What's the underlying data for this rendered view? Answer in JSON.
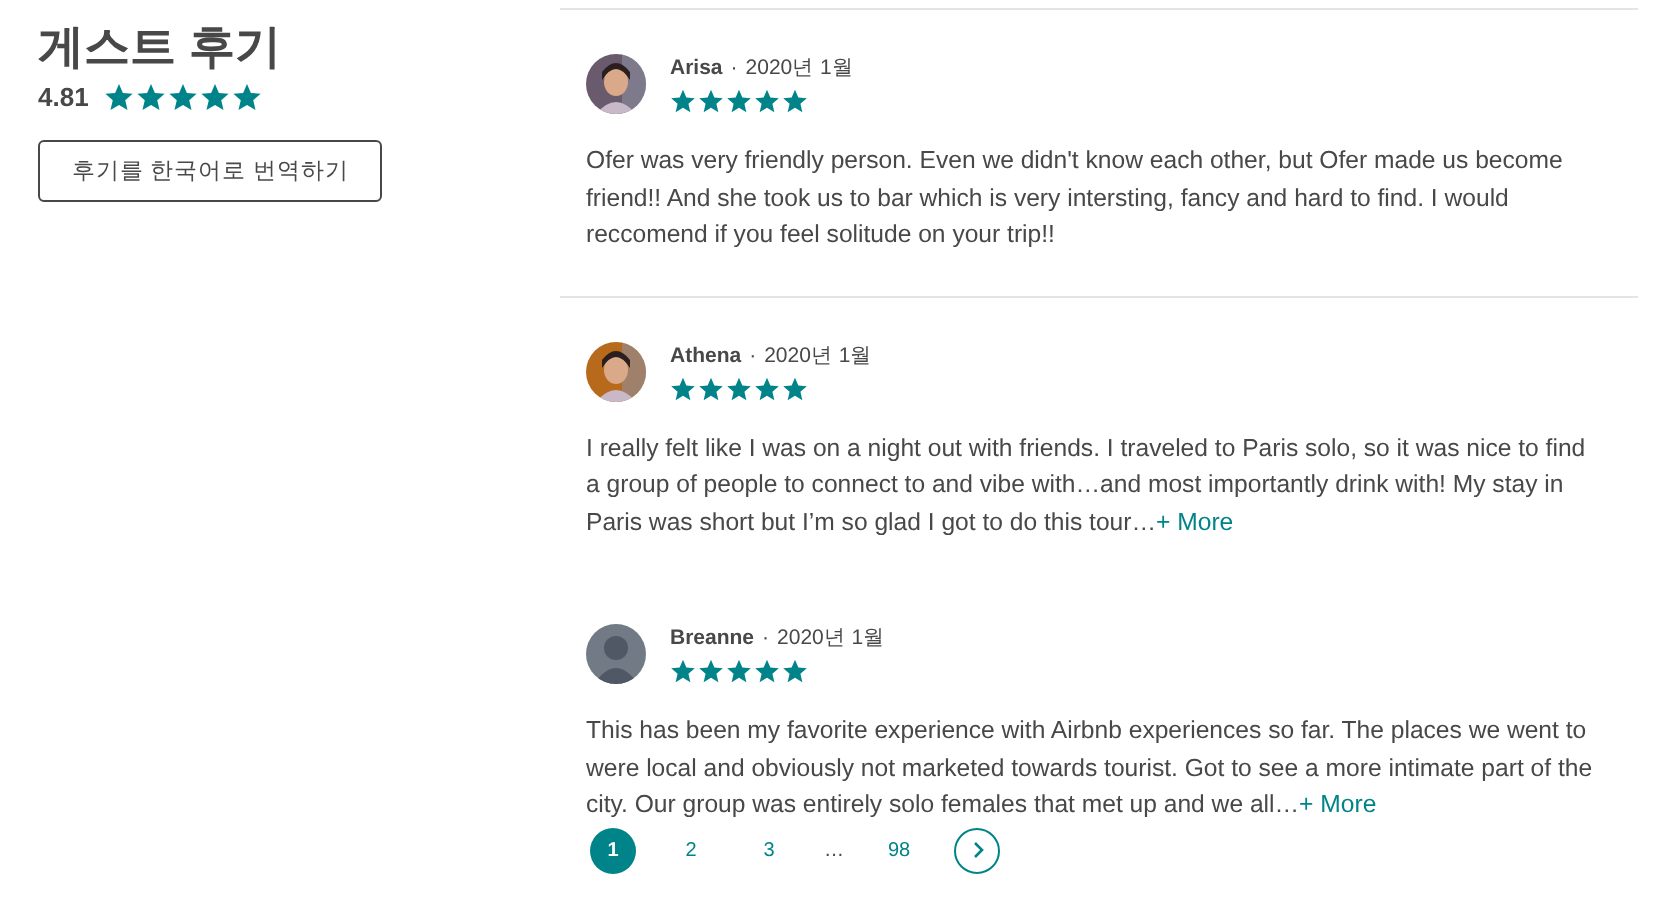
{
  "summary": {
    "title": "게스트 후기",
    "rating": "4.81",
    "stars": 5,
    "translate_button": "후기를 한국어로 번역하기"
  },
  "reviews": [
    {
      "name": "Arisa",
      "separator": "·",
      "date": "2020년 1월",
      "stars": 5,
      "text": "Ofer was very friendly person. Even we didn't know each other, but Ofer made us become friend!! And she took us to bar which is very intersting, fancy and hard to find. I would reccomend if you feel solitude on your trip!!"
    },
    {
      "name": "Athena",
      "separator": "·",
      "date": "2020년 1월",
      "stars": 5,
      "text": "I really felt like I was on a night out with friends. I traveled to Paris solo, so it was nice to find a group of people to connect to and vibe with…and most importantly drink with! My stay in Paris was short but I’m so glad I got to do this tour…",
      "more": "+ More"
    },
    {
      "name": "Breanne",
      "separator": "·",
      "date": "2020년 1월",
      "stars": 5,
      "avatar": {
        "kind": "default"
      },
      "text": "This has been my favorite experience with Airbnb experiences so far. The places we went to were local and obviously not marketed towards tourist. Got to see a more intimate part of the city. Our group was entirely solo females that met up and we all…",
      "more": "+ More"
    }
  ],
  "pagination": {
    "pages": [
      {
        "label": "1",
        "selected": true
      },
      {
        "label": "2",
        "selected": false
      },
      {
        "label": "3",
        "selected": false
      },
      {
        "label": "…",
        "kind": "ellipsis"
      },
      {
        "label": "98",
        "selected": false
      }
    ]
  }
}
